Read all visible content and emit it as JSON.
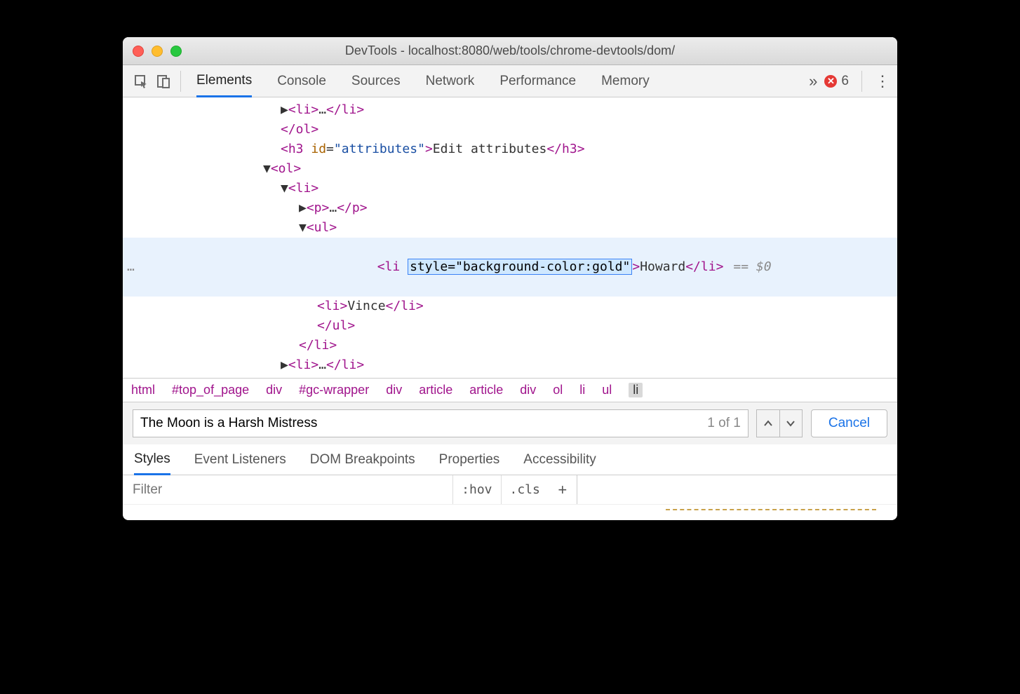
{
  "window": {
    "title": "DevTools - localhost:8080/web/tools/chrome-devtools/dom/"
  },
  "toolbar": {
    "tabs": [
      "Elements",
      "Console",
      "Sources",
      "Network",
      "Performance",
      "Memory"
    ],
    "active_tab": "Elements",
    "errors": "6",
    "more_glyph": "»",
    "menu_glyph": "⋮"
  },
  "dom": {
    "l0": "…",
    "close_ol": "</ol>",
    "h3_tag_open": "<h3 ",
    "h3_attr_name": "id",
    "h3_attr_val": "\"attributes\"",
    "h3_text": "Edit attributes",
    "h3_close": "</h3>",
    "ol_open": "<ol>",
    "li_open": "<li>",
    "p_open": "<p>",
    "p_dots": "…",
    "p_close": "</p>",
    "ul_open": "<ul>",
    "sel_li_open": "<li ",
    "sel_attr": "style=\"background-color:gold\"",
    "sel_close1": ">",
    "sel_text": "Howard",
    "sel_closetag": "</li>",
    "sel_hint": "== $0",
    "li_vince_open": "<li>",
    "li_vince_text": "Vince",
    "li_vince_close": "</li>",
    "ul_close": "</ul>",
    "li_close": "</li>",
    "li_dots": [
      "<li>",
      "…",
      "</li>"
    ],
    "ellipsis": "…"
  },
  "breadcrumbs": [
    "html",
    "#top_of_page",
    "div",
    "#gc-wrapper",
    "div",
    "article",
    "article",
    "div",
    "ol",
    "li",
    "ul",
    "li"
  ],
  "search": {
    "value": "The Moon is a Harsh Mistress",
    "count": "1 of 1",
    "cancel": "Cancel",
    "up": "⌃",
    "down": "⌄"
  },
  "subtabs": [
    "Styles",
    "Event Listeners",
    "DOM Breakpoints",
    "Properties",
    "Accessibility"
  ],
  "subtab_active": "Styles",
  "styles_panel": {
    "filter_placeholder": "Filter",
    "hov": ":hov",
    "cls": ".cls",
    "plus": "+"
  }
}
